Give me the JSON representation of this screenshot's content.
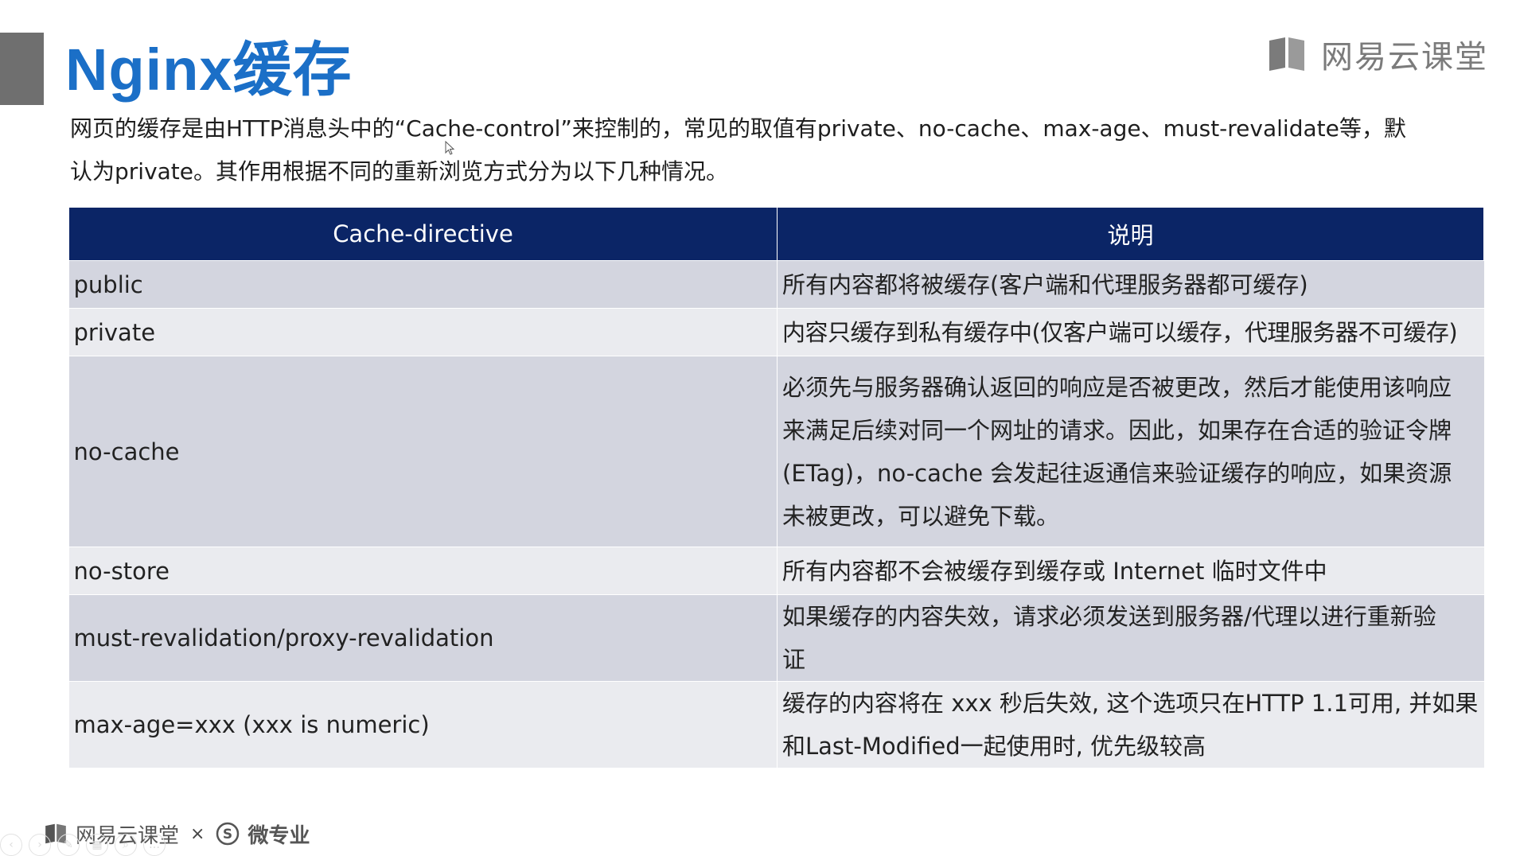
{
  "slide": {
    "title": "Nginx缓存",
    "intro_line1": "网页的缓存是由HTTP消息头中的“Cache-control”来控制的，常见的取值有private、no-cache、max-age、must-revalidate等，默",
    "intro_line2": "认为private。其作用根据不同的重新浏览方式分为以下几种情况。"
  },
  "brand": {
    "name": "网易云课堂",
    "icon": "book-icon"
  },
  "table": {
    "headers": [
      "Cache-directive",
      "说明"
    ],
    "rows": [
      {
        "directive": "public",
        "description": [
          "所有内容都将被缓存(客户端和代理服务器都可缓存)"
        ]
      },
      {
        "directive": "private",
        "description": [
          "内容只缓存到私有缓存中(仅客户端可以缓存，代理服务器不可缓存)"
        ]
      },
      {
        "directive": "no-cache",
        "description": [
          "必须先与服务器确认返回的响应是否被更改，然后才能使用该响应",
          "来满足后续对同一个网址的请求。因此，如果存在合适的验证令牌",
          "(ETag)，no-cache 会发起往返通信来验证缓存的响应，如果资源",
          "未被更改，可以避免下载。"
        ]
      },
      {
        "directive": "no-store",
        "description": [
          "所有内容都不会被缓存到缓存或 Internet 临时文件中"
        ]
      },
      {
        "directive": "must-revalidation/proxy-revalidation",
        "description": [
          "如果缓存的内容失效，请求必须发送到服务器/代理以进行重新验",
          "证"
        ]
      },
      {
        "directive": "max-age=xxx (xxx is numeric)",
        "description": [
          "缓存的内容将在 xxx 秒后失效, 这个选项只在HTTP 1.1可用, 并如果",
          "和Last-Modified一起使用时, 优先级较高"
        ]
      }
    ]
  },
  "footer": {
    "brand": "网易云课堂",
    "separator": "×",
    "partner_symbol": "S",
    "partner": "微专业"
  },
  "colors": {
    "title": "#1b6fc7",
    "header_bg": "#0b2566",
    "row_shade": "#d3d5df",
    "row_light": "#eaebef"
  }
}
